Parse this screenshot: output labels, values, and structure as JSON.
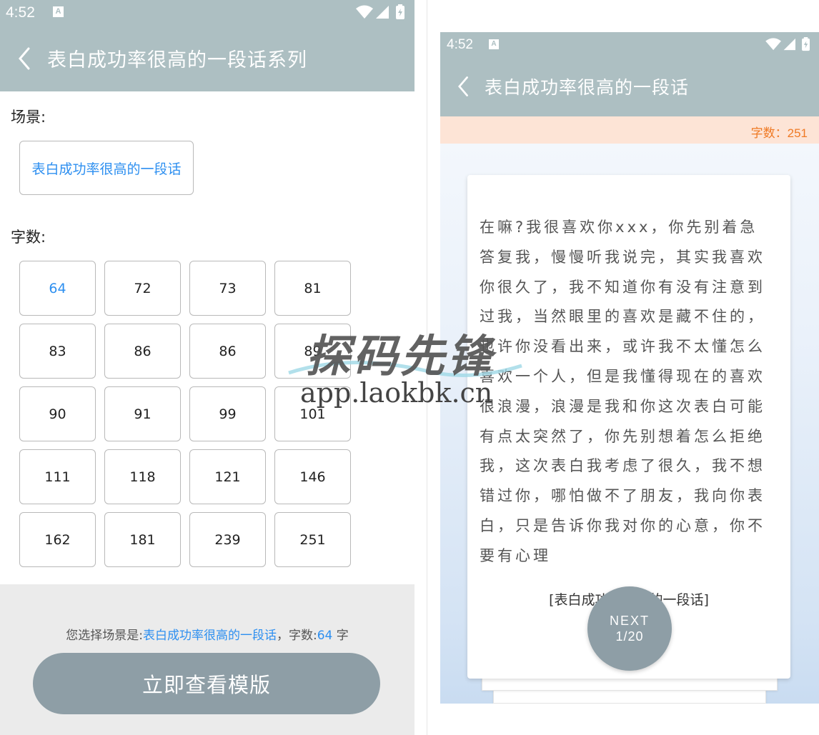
{
  "left": {
    "status": {
      "time": "4:52",
      "a_icon": "A"
    },
    "title": "表白成功率很高的一段话系列",
    "scene_label": "场景:",
    "scene_value": "表白成功率很高的一段话",
    "count_label": "字数:",
    "counts": [
      "64",
      "72",
      "73",
      "81",
      "83",
      "86",
      "86",
      "89",
      "90",
      "91",
      "99",
      "101",
      "111",
      "118",
      "121",
      "146",
      "162",
      "181",
      "239",
      "251"
    ],
    "selected_count": "64",
    "summary": {
      "prefix": "您选择场景是:",
      "scene": "表白成功率很高的一段话",
      "mid": "，字数:",
      "count": "64",
      "suffix": " 字"
    },
    "view_button": "立即查看模版"
  },
  "right": {
    "status": {
      "time": "4:52",
      "a_icon": "A"
    },
    "title": "表白成功率很高的一段话",
    "char_count": "字数：251",
    "body_text": "在嘛?我很喜欢你xxx，你先别着急答复我，慢慢听我说完，其实我喜欢你很久了，我不知道你有没有注意到过我，当然眼里的喜欢是藏不住的，也许你没看出来，或许我不太懂怎么喜欢一个人，但是我懂得现在的喜欢很浪漫，浪漫是我和你这次表白可能有点太突然了，你先别想着怎么拒绝我，这次表白我考虑了很久，我不想错过你，哪怕做不了朋友，我向你表白，只是告诉你我对你的心意，你不要有心理",
    "caption": "[表白成功率很高的一段话]",
    "next_label": "NEXT",
    "page": "1/20"
  },
  "watermark": {
    "cn": "探码先锋",
    "url": "app.laokbk.cn"
  },
  "colors": {
    "appbar": "#adbfc2",
    "accent": "#2d8ff0",
    "button": "#8e9ea6",
    "count_text": "#ef7a25",
    "count_bar": "#fde4d6"
  },
  "icons": [
    "back-arrow-icon",
    "wifi-icon",
    "signal-icon",
    "battery-icon",
    "a-notification-icon"
  ]
}
